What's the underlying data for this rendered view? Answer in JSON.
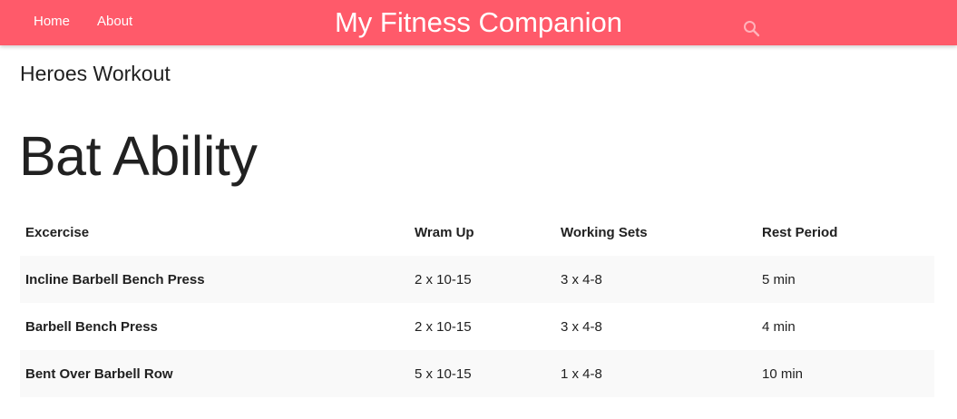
{
  "nav": {
    "links": [
      "Home",
      "About"
    ],
    "brand": "My Fitness Companion",
    "search_icon": "search-icon",
    "color": "#ff5a6a"
  },
  "subtitle": "Heroes Workout",
  "title": "Bat Ability",
  "table": {
    "headers": [
      "Excercise",
      "Wram Up",
      "Working Sets",
      "Rest Period"
    ],
    "rows": [
      [
        "Incline Barbell Bench Press",
        "2 x 10-15",
        "3 x 4-8",
        "5 min"
      ],
      [
        "Barbell Bench Press",
        "2 x 10-15",
        "3 x 4-8",
        "4 min"
      ],
      [
        "Bent Over Barbell Row",
        "5 x 10-15",
        "1 x 4-8",
        "10 min"
      ]
    ]
  }
}
